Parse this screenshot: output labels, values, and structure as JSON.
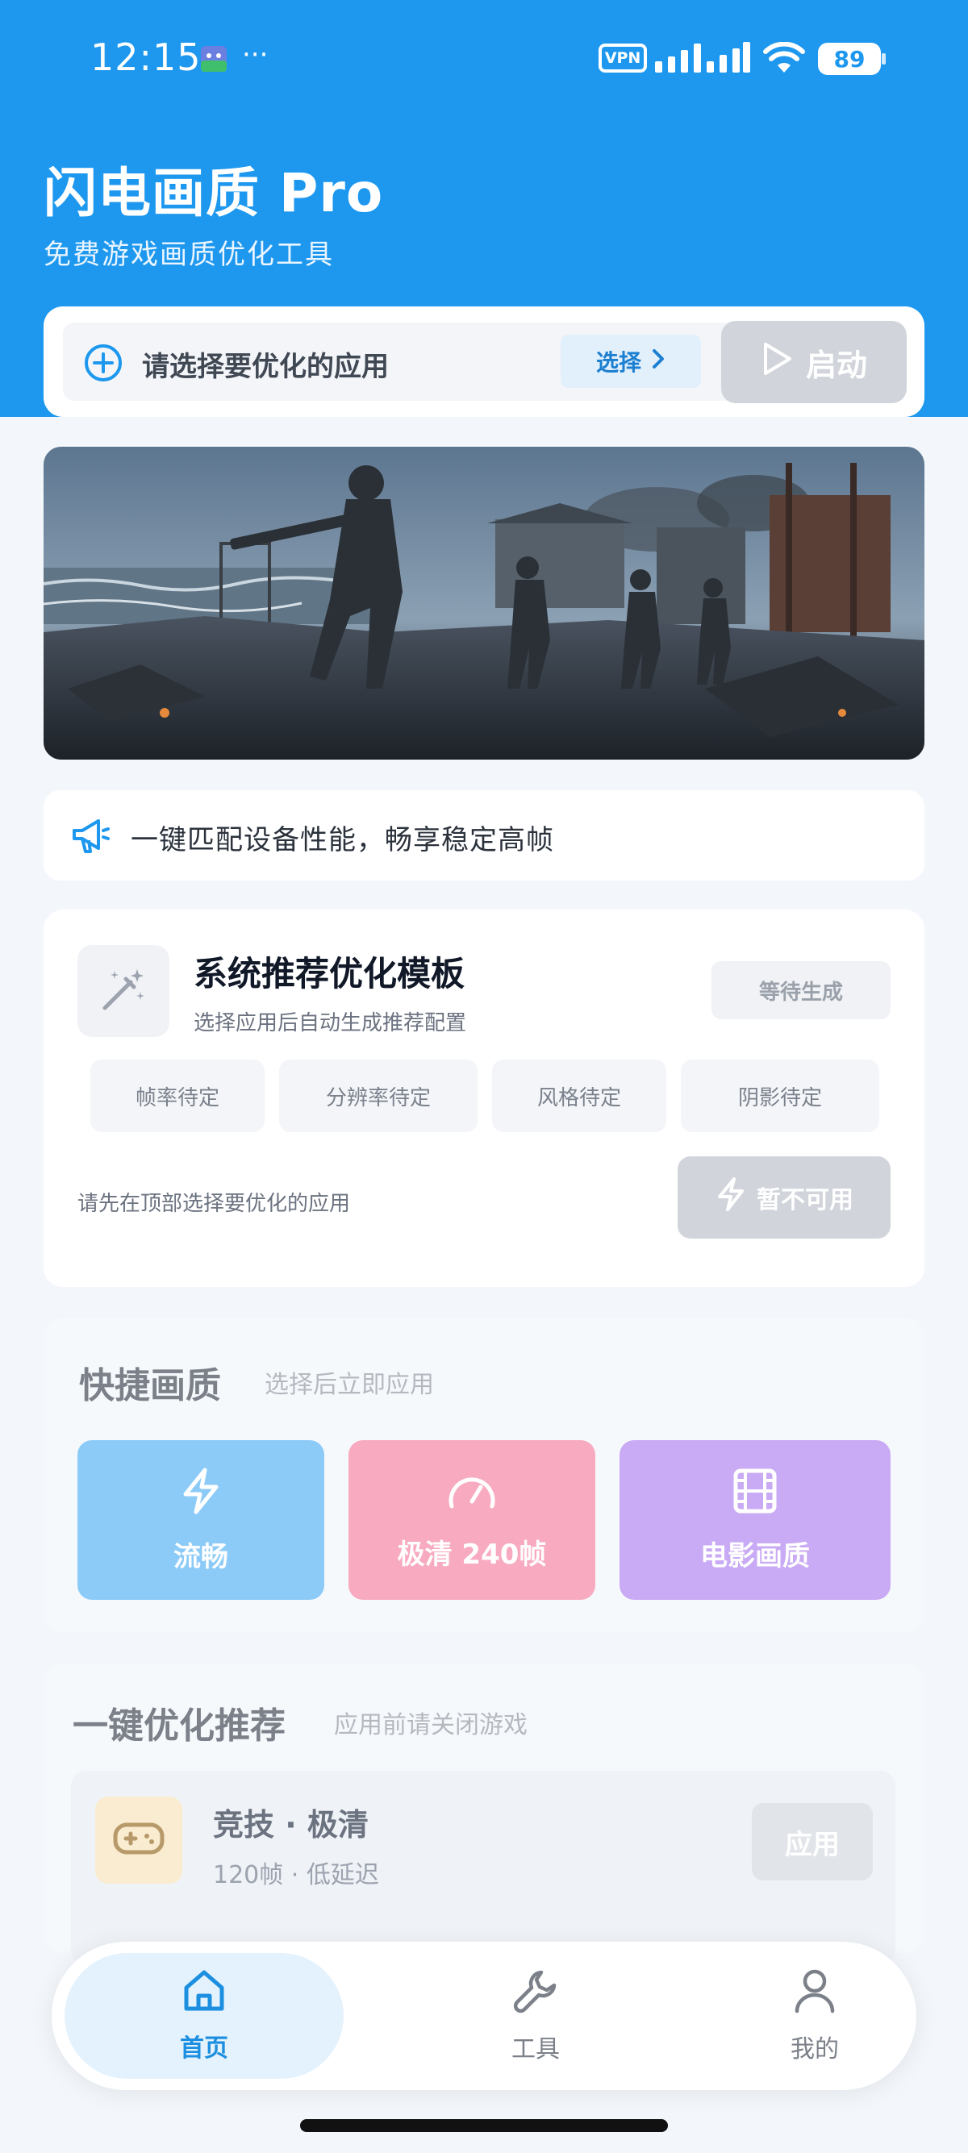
{
  "status_bar": {
    "time": "12:15",
    "dots": "···",
    "vpn": "VPN",
    "battery": "89"
  },
  "header": {
    "title": "闪电画质 Pro",
    "subtitle": "免费游戏画质优化工具"
  },
  "app_selector": {
    "placeholder": "请选择要优化的应用",
    "select_label": "选择",
    "start_label": "启动"
  },
  "notice": {
    "text": "一键匹配设备性能，畅享稳定高帧"
  },
  "template_card": {
    "title": "系统推荐优化模板",
    "subtitle": "选择应用后自动生成推荐配置",
    "status": "等待生成",
    "chips": [
      "帧率待定",
      "分辨率待定",
      "风格待定",
      "阴影待定"
    ],
    "hint": "请先在顶部选择要优化的应用",
    "action_label": "暂不可用"
  },
  "quick_quality": {
    "title": "快捷画质",
    "subtitle": "选择后立即应用",
    "options": [
      {
        "label": "流畅",
        "icon": "lightning-icon",
        "color": "#8ccbf8"
      },
      {
        "label": "极清 240帧",
        "icon": "speedometer-icon",
        "color": "#f8abc0"
      },
      {
        "label": "电影画质",
        "icon": "film-icon",
        "color": "#c9aaf4"
      }
    ]
  },
  "one_click": {
    "title": "一键优化推荐",
    "subtitle": "应用前请关闭游戏",
    "item": {
      "name": "竞技 · 极清",
      "meta": "120帧 · 低延迟",
      "apply_label": "应用"
    }
  },
  "bottom_nav": {
    "items": [
      {
        "label": "首页",
        "icon": "home-icon",
        "active": true
      },
      {
        "label": "工具",
        "icon": "wrench-icon",
        "active": false
      },
      {
        "label": "我的",
        "icon": "user-icon",
        "active": false
      }
    ]
  },
  "colors": {
    "primary": "#1e98ef",
    "background": "#f3f6fa",
    "disabled": "#d1d5db"
  }
}
